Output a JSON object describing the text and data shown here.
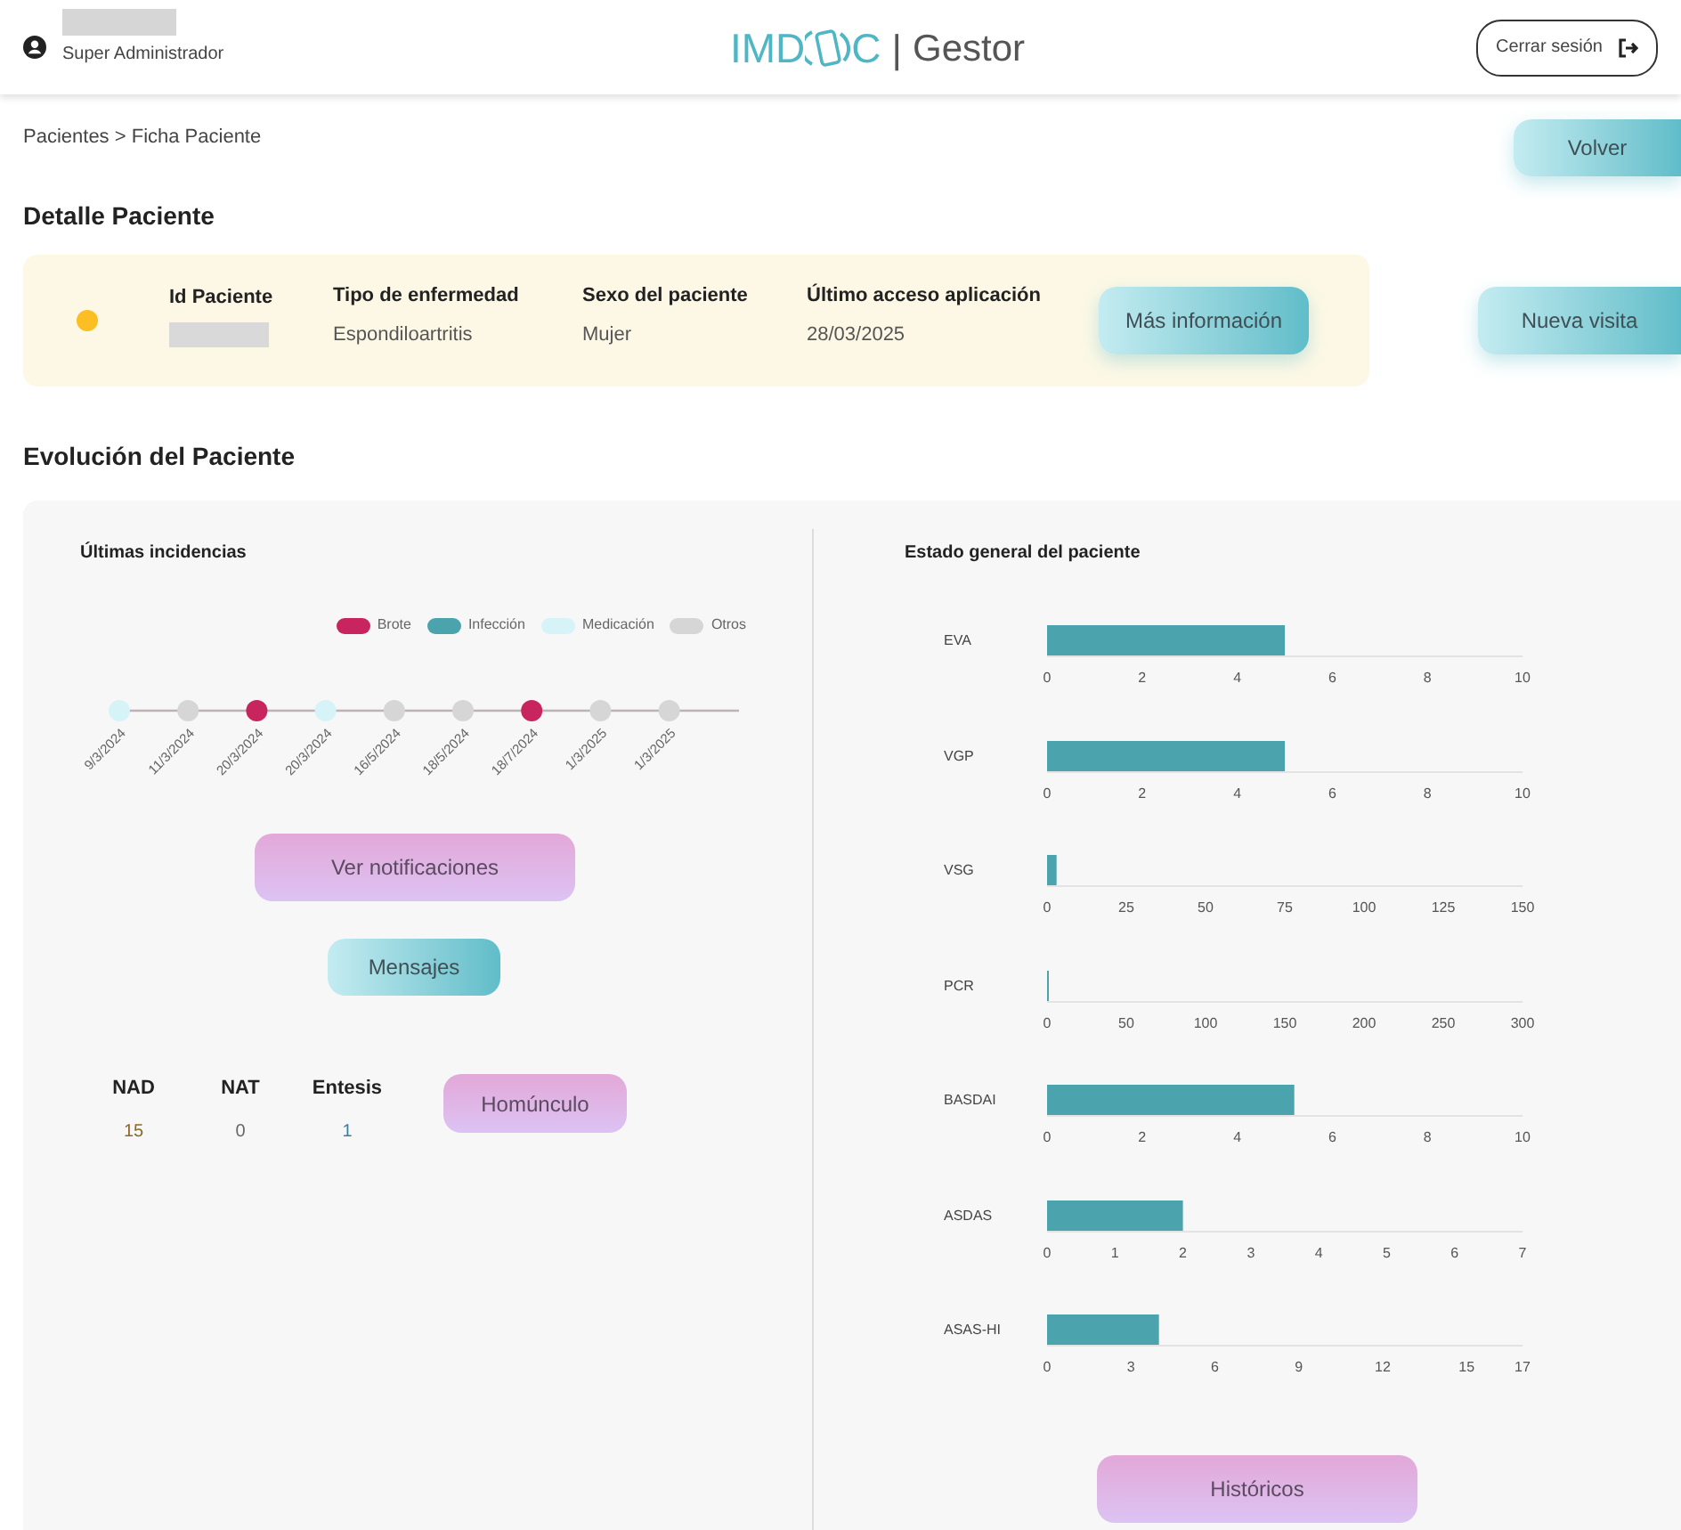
{
  "header": {
    "role": "Super Administrador",
    "logo": {
      "before": "IMD",
      "after": "C",
      "separator": "|",
      "product": "Gestor"
    },
    "logout": "Cerrar sesión"
  },
  "breadcrumb": "Pacientes > Ficha Paciente",
  "back_button": "Volver",
  "detail_title": "Detalle Paciente",
  "patient": {
    "status": {
      "color": "#fbbf24"
    },
    "fields": [
      {
        "label": "Id Paciente",
        "redacted": true
      },
      {
        "label": "Tipo de enfermedad",
        "value": "Espondiloartritis"
      },
      {
        "label": "Sexo del paciente",
        "value": "Mujer"
      },
      {
        "label": "Último acceso aplicación",
        "value": "28/03/2025"
      }
    ],
    "more_button": "Más información"
  },
  "new_visit_button": "Nueva visita",
  "evolution_title": "Evolución del Paciente",
  "incidents": {
    "title": "Últimas incidencias",
    "legend": [
      {
        "label": "Brote",
        "color": "#c8255e"
      },
      {
        "label": "Infección",
        "color": "#4ba3ad"
      },
      {
        "label": "Medicación",
        "color": "#d6f3f8"
      },
      {
        "label": "Otros",
        "color": "#d6d6d6"
      }
    ],
    "events": [
      {
        "date": "9/3/2024",
        "color": "#d6f3f8"
      },
      {
        "date": "11/3/2024",
        "color": "#d6d6d6"
      },
      {
        "date": "20/3/2024",
        "color": "#c8255e"
      },
      {
        "date": "20/3/2024",
        "color": "#d6f3f8"
      },
      {
        "date": "16/5/2024",
        "color": "#d6d6d6"
      },
      {
        "date": "18/5/2024",
        "color": "#d6d6d6"
      },
      {
        "date": "18/7/2024",
        "color": "#c8255e"
      },
      {
        "date": "1/3/2025",
        "color": "#d6d6d6"
      },
      {
        "date": "1/3/2025",
        "color": "#d6d6d6"
      }
    ],
    "notifications_button": "Ver notificaciones",
    "messages_button": "Mensajes",
    "counts": [
      {
        "label": "NAD",
        "value": "15"
      },
      {
        "label": "NAT",
        "value": "0"
      },
      {
        "label": "Entesis",
        "value": "1"
      }
    ],
    "homunculus_button": "Homúnculo"
  },
  "general_state": {
    "title": "Estado general del paciente",
    "charts": [
      {
        "chart_data": {
          "type": "bar",
          "orientation": "horizontal",
          "categories": [
            "EVA"
          ],
          "series": [
            {
              "color": "#4ba3ad",
              "values": [
                5
              ]
            }
          ],
          "xlim": [
            0,
            10
          ],
          "xticks": [
            0,
            2,
            4,
            6,
            8,
            10
          ]
        }
      },
      {
        "chart_data": {
          "type": "bar",
          "orientation": "horizontal",
          "categories": [
            "VGP"
          ],
          "series": [
            {
              "color": "#4ba3ad",
              "values": [
                5
              ]
            }
          ],
          "xlim": [
            0,
            10
          ],
          "xticks": [
            0,
            2,
            4,
            6,
            8,
            10
          ]
        }
      },
      {
        "chart_data": {
          "type": "bar",
          "orientation": "horizontal",
          "categories": [
            "VSG"
          ],
          "series": [
            {
              "color": "#4ba3ad",
              "values": [
                3
              ]
            }
          ],
          "xlim": [
            0,
            150
          ],
          "xticks": [
            0,
            25,
            50,
            75,
            100,
            125,
            150
          ]
        }
      },
      {
        "chart_data": {
          "type": "bar",
          "orientation": "horizontal",
          "categories": [
            "PCR"
          ],
          "series": [
            {
              "color": "#4ba3ad",
              "values": [
                1
              ]
            }
          ],
          "xlim": [
            0,
            300
          ],
          "xticks": [
            0,
            50,
            100,
            150,
            200,
            250,
            300
          ]
        }
      },
      {
        "chart_data": {
          "type": "bar",
          "orientation": "horizontal",
          "categories": [
            "BASDAI"
          ],
          "series": [
            {
              "color": "#4ba3ad",
              "values": [
                5.2
              ]
            }
          ],
          "xlim": [
            0,
            10
          ],
          "xticks": [
            0,
            2,
            4,
            6,
            8,
            10
          ]
        }
      },
      {
        "chart_data": {
          "type": "bar",
          "orientation": "horizontal",
          "categories": [
            "ASDAS"
          ],
          "series": [
            {
              "color": "#4ba3ad",
              "values": [
                2
              ]
            }
          ],
          "xlim": [
            0,
            7
          ],
          "xticks": [
            0,
            1,
            2,
            3,
            4,
            5,
            6,
            7
          ]
        }
      },
      {
        "chart_data": {
          "type": "bar",
          "orientation": "horizontal",
          "categories": [
            "ASAS-HI"
          ],
          "series": [
            {
              "color": "#4ba3ad",
              "values": [
                4
              ]
            }
          ],
          "xlim": [
            0,
            17
          ],
          "xticks": [
            0,
            3,
            6,
            9,
            12,
            15,
            17
          ]
        }
      }
    ],
    "history_button": "Históricos"
  }
}
